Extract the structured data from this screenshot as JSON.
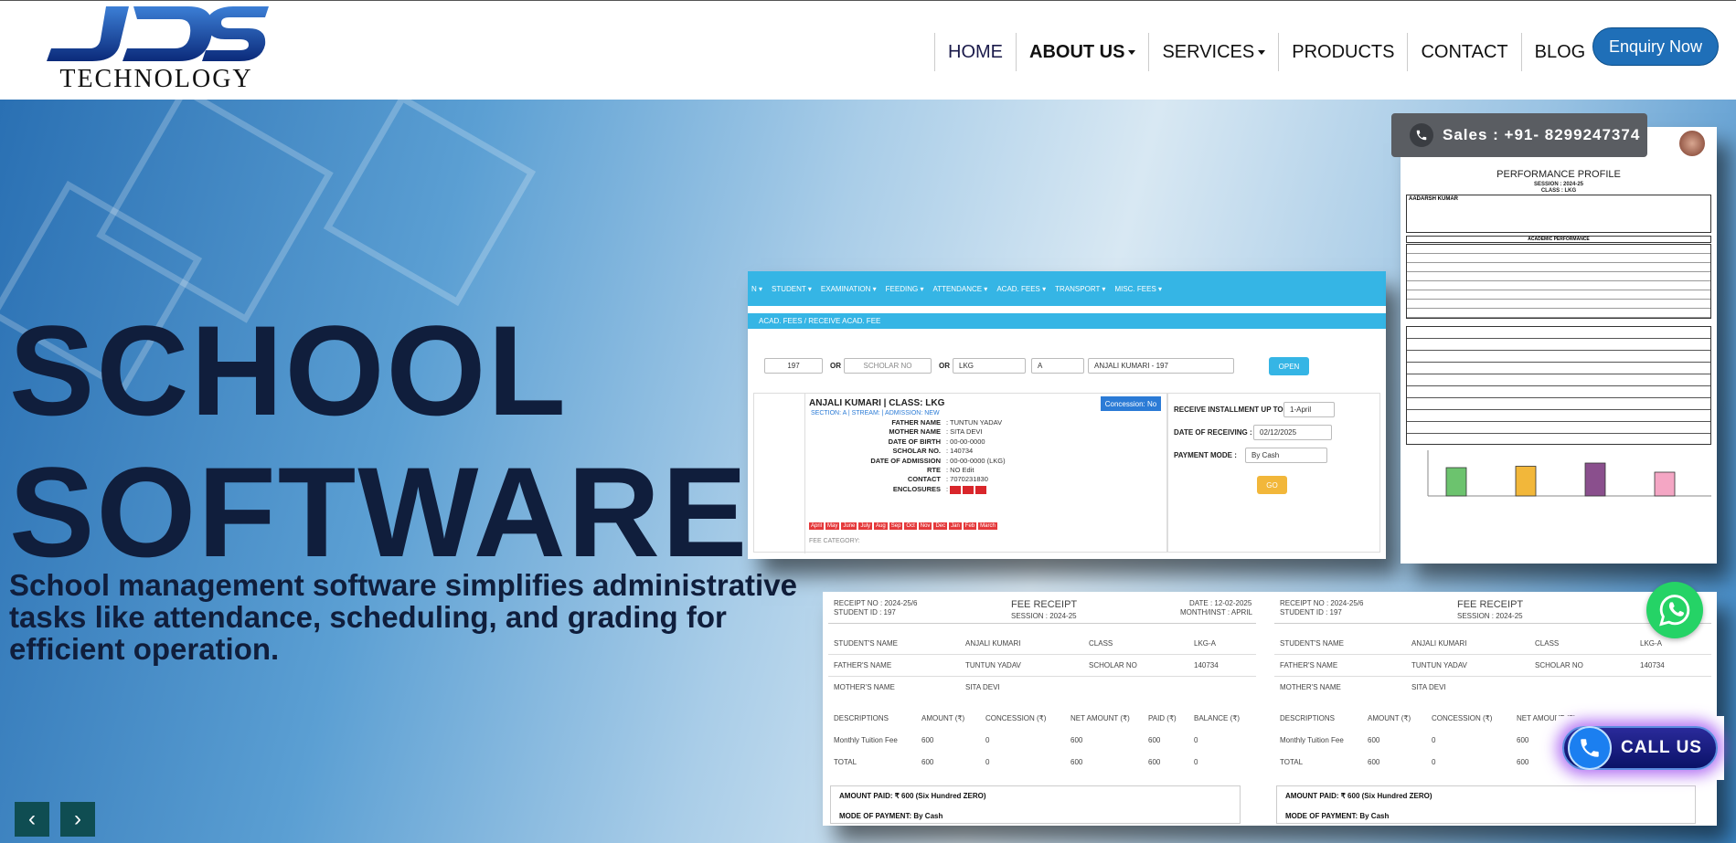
{
  "brand": {
    "logo_text": "TECHNOLOGY",
    "logo_mark": "JDS"
  },
  "nav": {
    "home": "HOME",
    "about": "ABOUT US",
    "services": "SERVICES",
    "products": "PRODUCTS",
    "contact": "CONTACT",
    "blog": "BLOG"
  },
  "enquiry_label": "Enquiry Now",
  "hero": {
    "title_line1": "SCHOOL",
    "title_line2": "SOFTWARE",
    "subtitle": "School management software simplifies administrative tasks like attendance, scheduling, and grading for efficient operation."
  },
  "sales_label": "Sales : +91- 8299247374",
  "call_us_label": "CALL US",
  "app": {
    "menu": [
      "N ▾",
      "STUDENT ▾",
      "EXAMINATION ▾",
      "FEEDING ▾",
      "ATTENDANCE ▾",
      "ACAD. FEES ▾",
      "TRANSPORT ▾",
      "MISC. FEES ▾"
    ],
    "breadcrumb": "ACAD. FEES / RECEIVE ACAD. FEE",
    "id_value": "197",
    "or1": "OR",
    "scholar_placeholder": "SCHOLAR NO",
    "or2": "OR",
    "class_value": "LKG",
    "section_value": "A",
    "student_select": "ANJALI KUMARI - 197",
    "open_button": "OPEN",
    "student_heading": "ANJALI KUMARI | CLASS: LKG",
    "student_sub": "SECTION: A | STREAM: | ADMISSION: NEW",
    "concession": "Concession: No",
    "fields": [
      {
        "k": "FATHER NAME",
        "v": ": TUNTUN YADAV"
      },
      {
        "k": "MOTHER NAME",
        "v": ": SITA DEVI"
      },
      {
        "k": "DATE OF BIRTH",
        "v": ": 00-00-0000"
      },
      {
        "k": "SCHOLAR NO.",
        "v": ": 140734"
      },
      {
        "k": "DATE OF ADMISSION",
        "v": ": 00-00-0000 (LKG)"
      },
      {
        "k": "RTE",
        "v": ": NO  Edit"
      },
      {
        "k": "CONTACT",
        "v": ": 7070231830"
      },
      {
        "k": "ENCLOSURES",
        "v": ":"
      }
    ],
    "months": [
      "April",
      "May",
      "June",
      "July",
      "Aug",
      "Sep",
      "Oct",
      "Nov",
      "Dec",
      "Jan",
      "Feb",
      "March"
    ],
    "fee_category": "FEE CATEGORY:",
    "receive_label": "RECEIVE INSTALLMENT UP TO :",
    "receive_value": "1-April",
    "date_label": "DATE OF RECEIVING :",
    "date_value": "02/12/2025",
    "mode_label": "PAYMENT MODE :",
    "mode_value": "By Cash",
    "go_button": "GO"
  },
  "receipt": {
    "receipt_no": "RECEIPT NO : 2024-25/6",
    "student_id": "STUDENT ID : 197",
    "title": "FEE RECEIPT",
    "session": "SESSION : 2024-25",
    "date": "DATE : 12-02-2025",
    "month": "MONTH/INST : APRIL",
    "student_name_k": "STUDENT'S NAME",
    "student_name_v": "ANJALI KUMARI",
    "class_k": "CLASS",
    "class_v": "LKG-A",
    "father_k": "FATHER'S NAME",
    "father_v": "TUNTUN YADAV",
    "scholar_k": "SCHOLAR NO",
    "scholar_v": "140734",
    "mother_k": "MOTHER'S NAME",
    "mother_v": "SITA DEVI",
    "cols": [
      "DESCRIPTIONS",
      "AMOUNT (₹)",
      "CONCESSION (₹)",
      "NET AMOUNT (₹)",
      "PAID (₹)",
      "BALANCE (₹)"
    ],
    "row1": [
      "Monthly Tuition Fee",
      "600",
      "0",
      "600",
      "600",
      "0"
    ],
    "row2": [
      "TOTAL",
      "600",
      "0",
      "600",
      "600",
      "0"
    ],
    "amount_paid": "AMOUNT PAID: ₹ 600 (Six Hundred ZERO)",
    "mode": "MODE OF PAYMENT: By Cash"
  },
  "profile": {
    "title": "PERFORMANCE PROFILE",
    "session": "SESSION : 2024-25",
    "class": "CLASS : LKG",
    "student": "AADARSH KUMAR",
    "section_title": "ACADEMIC PERFORMANCE",
    "bar_values": [
      0.62,
      0.65,
      0.72,
      0.52
    ]
  },
  "colors": {
    "accent": "#35b5e5",
    "brand_blue": "#1f6fb8",
    "title": "#101e3c"
  }
}
